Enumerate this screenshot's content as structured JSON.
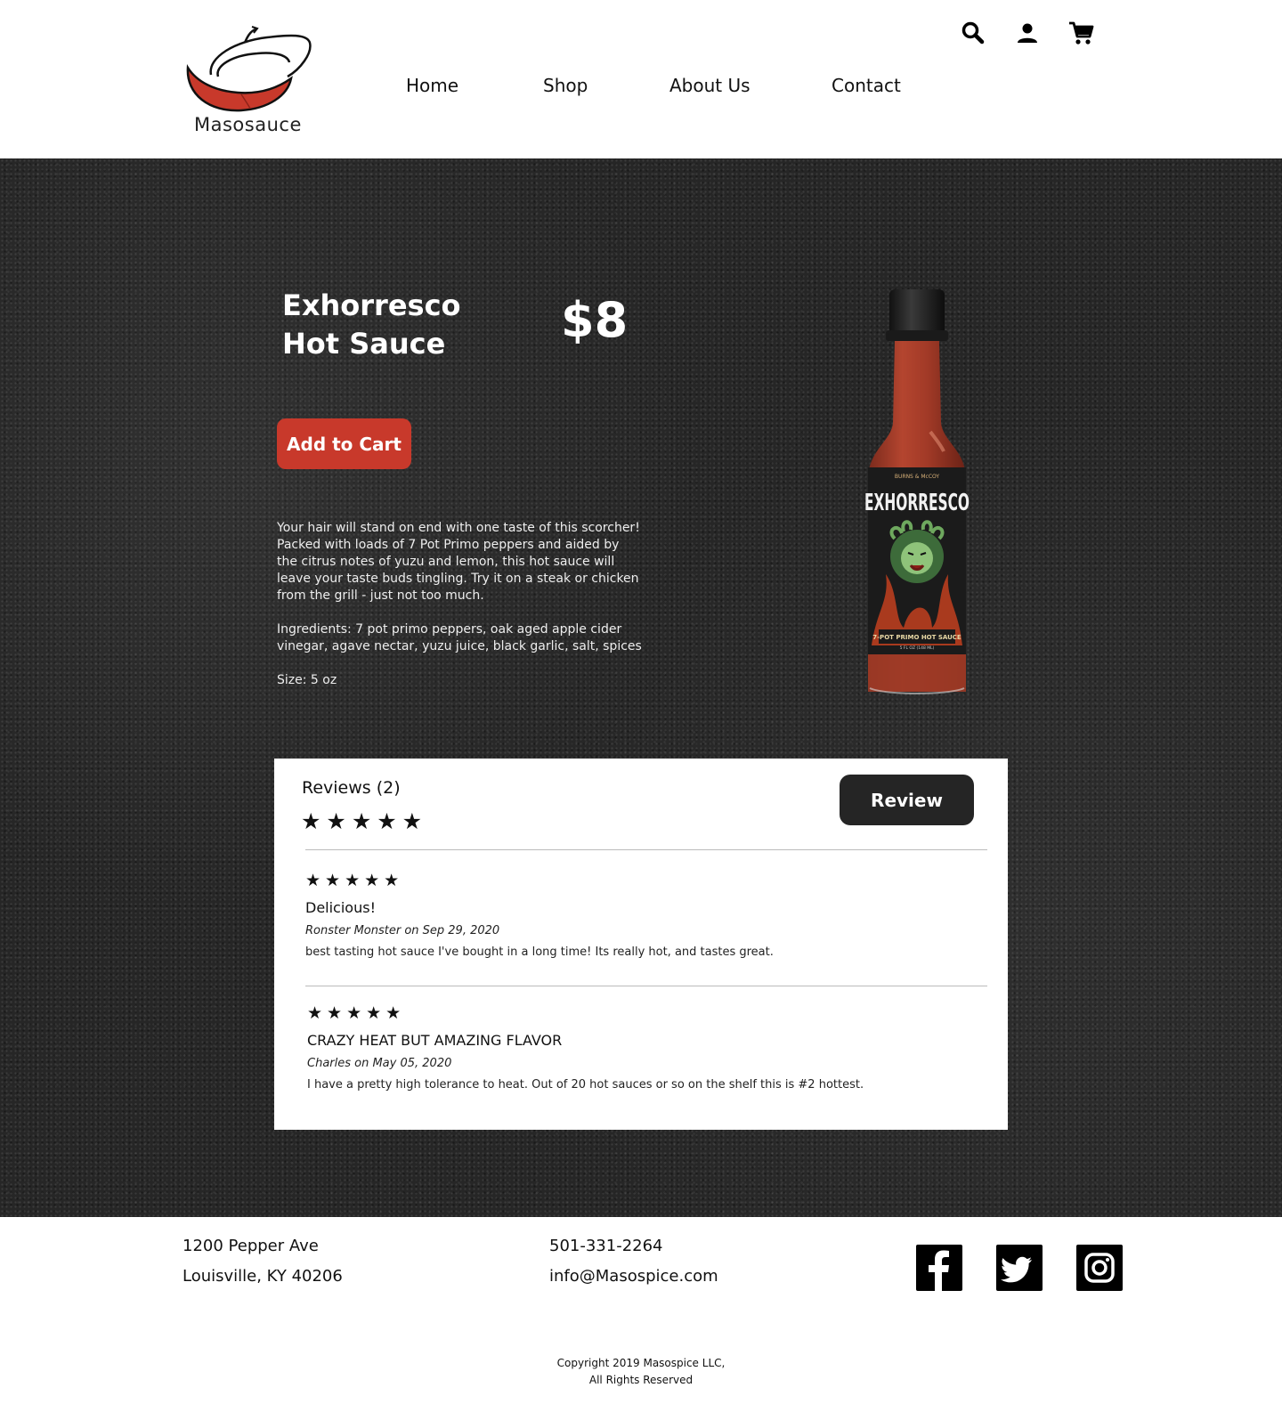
{
  "brand": {
    "name": "Masosauce",
    "accent": "#c8392b"
  },
  "nav": {
    "items": [
      {
        "label": "Home"
      },
      {
        "label": "Shop"
      },
      {
        "label": "About Us"
      },
      {
        "label": "Contact"
      }
    ]
  },
  "header_icons": [
    "search-icon",
    "account-icon",
    "cart-icon"
  ],
  "product": {
    "title_line1": "Exhorresco",
    "title_line2": "Hot Sauce",
    "price": "$8",
    "add_to_cart_label": "Add to Cart",
    "description": "Your hair will stand on end with one taste of this scorcher! Packed with loads of 7 Pot Primo peppers and aided by the citrus notes of yuzu and lemon, this hot sauce will leave your taste buds tingling. Try it on a steak or chicken from the grill - just not too much.",
    "ingredients": "Ingredients: 7 pot primo peppers, oak aged apple cider vinegar, agave nectar, yuzu juice, black garlic, salt, spices",
    "size": "Size: 5 oz",
    "bottle_label": {
      "maker": "BURNS & McCOY",
      "name": "EXHORRESCO",
      "subtitle": "7-POT PRIMO HOT SAUCE",
      "volume": "5 FL OZ (148 ML)"
    }
  },
  "reviews": {
    "heading": "Reviews (2)",
    "overall_stars": "★★★★★",
    "rating": 5,
    "review_button_label": "Review",
    "items": [
      {
        "stars": "★★★★★",
        "title": "Delicious!",
        "meta": "Ronster Monster on Sep 29, 2020",
        "body": "best tasting hot sauce I've bought in a long time! Its really hot, and tastes great."
      },
      {
        "stars": "★★★★★",
        "title": "CRAZY HEAT BUT AMAZING FLAVOR",
        "meta": "Charles on May 05, 2020",
        "body": "I have a pretty high tolerance to heat. Out of 20 hot sauces or so on the shelf this is #2 hottest."
      }
    ]
  },
  "footer": {
    "address_line1": "1200 Pepper Ave",
    "address_line2": "Louisville, KY 40206",
    "phone": "501-331-2264",
    "email": "info@Masospice.com",
    "social_icons": [
      "facebook-icon",
      "twitter-icon",
      "instagram-icon"
    ],
    "copyright_line1": "Copyright 2019 Masospice LLC,",
    "copyright_line2": "All Rights Reserved"
  }
}
